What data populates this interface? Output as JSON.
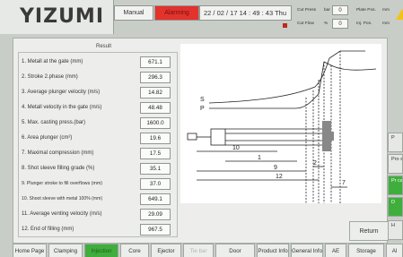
{
  "header": {
    "logo": "YIZUMI",
    "mode": "Manual",
    "alarm": "Alarming",
    "clock": "22 / 02 / 17   14 : 49 : 43   Thu",
    "cut_press_label": "Cut Press",
    "cut_press_unit": "bar",
    "cut_press_value": "0",
    "cut_flow_label": "Cut Flow",
    "cut_flow_unit": "%",
    "cut_flow_value": "0",
    "plate_pos_label": "Plate Pos.",
    "plate_pos_unit": "mm",
    "inj_pos_label": "Inj. Pos.",
    "inj_pos_unit": "mm"
  },
  "result": {
    "title": "Result",
    "rows": [
      {
        "label": "1.   Metall at the gate (mm)",
        "value": "671.1"
      },
      {
        "label": "2.   Stroke 2.phase (mm)",
        "value": "296.3"
      },
      {
        "label": "3.   Average plunger velocity (m/s)",
        "value": "14.82"
      },
      {
        "label": "4.   Metall velocity in the gate (m/s)",
        "value": "48.48"
      },
      {
        "label": "5.   Max. casting press.(bar)",
        "value": "1600.0"
      },
      {
        "label": "6.   Area plunger (cm²)",
        "value": "19.6"
      },
      {
        "label": "7.   Maximal compression (mm)",
        "value": "17.5"
      },
      {
        "label": "8.   Shot sleeve filling grade (%)",
        "value": "35.1"
      },
      {
        "label": "9.   Plunger stroke to fill overflows (mm)",
        "value": "37.0"
      },
      {
        "label": "10.  Shoot sleeve with metal 100% (mm)",
        "value": "649.1"
      },
      {
        "label": "11.  Average venting velocity (m/s)",
        "value": "29.09"
      },
      {
        "label": "12.  End of filling (mm)",
        "value": "967.5"
      }
    ]
  },
  "diagram": {
    "s_label": "S",
    "p_label": "P",
    "dim_labels": [
      "10",
      "1",
      "9",
      "12",
      "2",
      "7"
    ]
  },
  "return_label": "Return",
  "right_stubs": [
    "P",
    "Pro sto",
    "Pr calc",
    "D",
    "H",
    "Al"
  ],
  "bottom_tabs": [
    {
      "label": "Home Page",
      "state": "normal"
    },
    {
      "label": "Clamping",
      "state": "normal"
    },
    {
      "label": "Injection",
      "state": "active"
    },
    {
      "label": "Core",
      "state": "normal"
    },
    {
      "label": "Ejector",
      "state": "normal"
    },
    {
      "label": "Tie bar",
      "state": "disabled"
    },
    {
      "label": "Door",
      "state": "normal"
    },
    {
      "label": "Product Info",
      "state": "normal"
    },
    {
      "label": "General Info",
      "state": "normal"
    },
    {
      "label": "AE",
      "state": "normal"
    },
    {
      "label": "Storage",
      "state": "normal"
    }
  ],
  "colors": {
    "alarm": "#e4322d",
    "active_tab": "#3fae3c",
    "warning": "#f2c316"
  }
}
